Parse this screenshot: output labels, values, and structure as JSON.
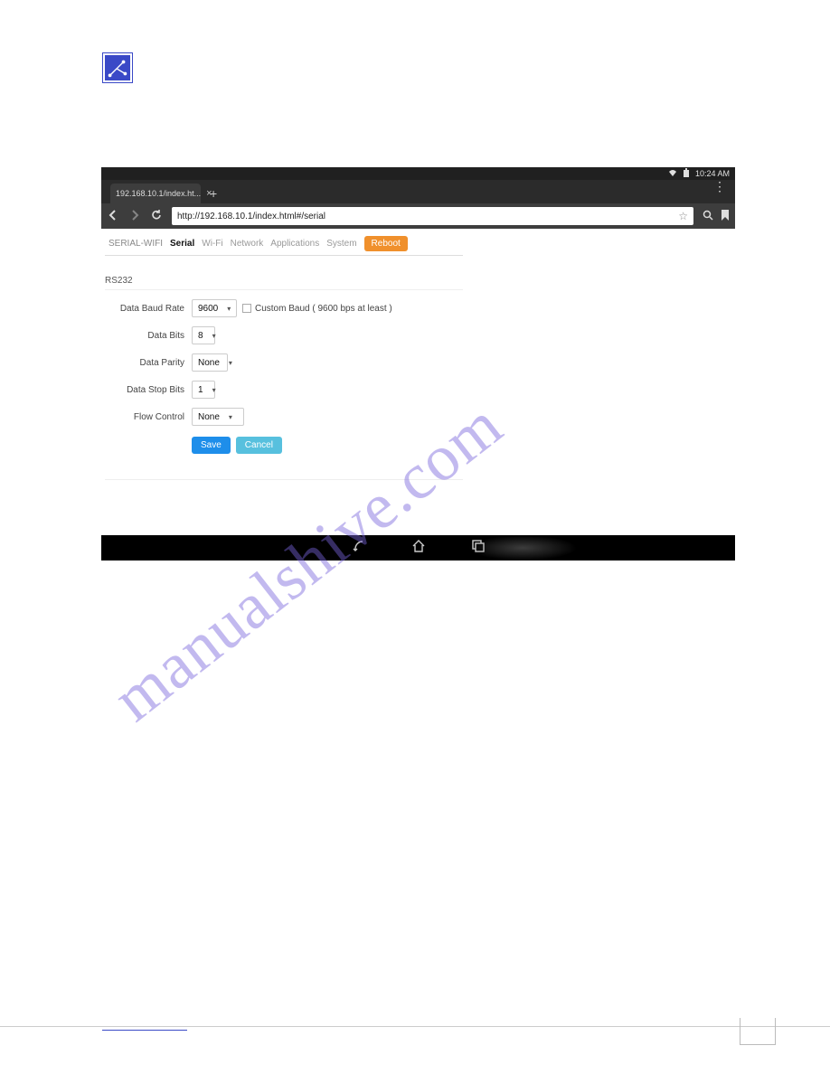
{
  "watermark": "manualshive.com",
  "statusbar": {
    "time": "10:24 AM"
  },
  "browser": {
    "tab_title": "192.168.10.1/index.ht...",
    "url": "http://192.168.10.1/index.html#/serial"
  },
  "nav": {
    "brand": "SERIAL-WIFI",
    "tabs": [
      "Serial",
      "Wi-Fi",
      "Network",
      "Applications",
      "System"
    ],
    "active_tab": "Serial",
    "reboot_label": "Reboot"
  },
  "section_title": "RS232",
  "form": {
    "rows": {
      "baud": {
        "label": "Data Baud Rate",
        "value": "9600",
        "checkbox_label": "Custom Baud ( 9600 bps at least )"
      },
      "bits": {
        "label": "Data Bits",
        "value": "8"
      },
      "parity": {
        "label": "Data Parity",
        "value": "None"
      },
      "stop": {
        "label": "Data Stop Bits",
        "value": "1"
      },
      "flow": {
        "label": "Flow Control",
        "value": "None"
      }
    },
    "save_label": "Save",
    "cancel_label": "Cancel"
  }
}
